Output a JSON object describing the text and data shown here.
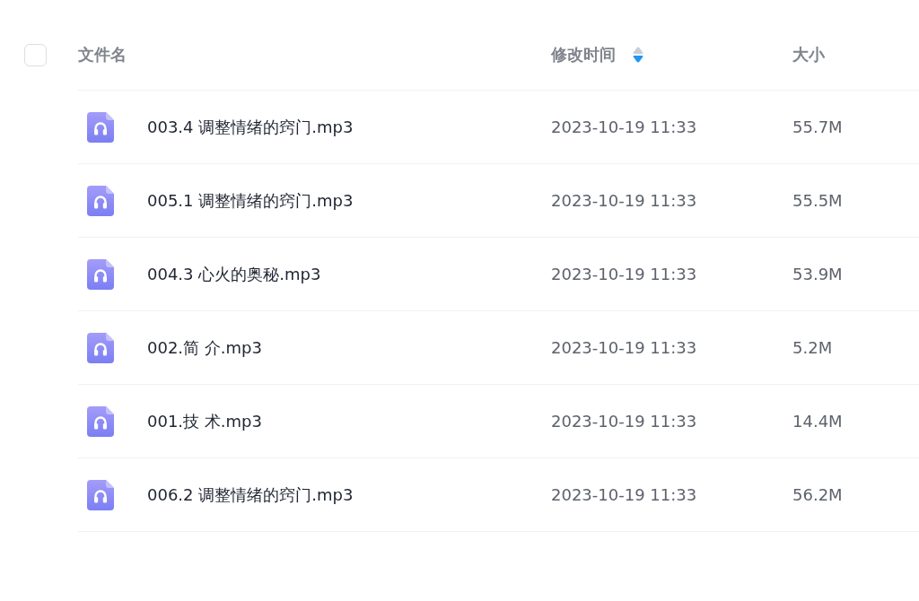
{
  "select_all_checkbox": {
    "checked": false
  },
  "table": {
    "columns": [
      {
        "label": "文件名"
      },
      {
        "label": "修改时间",
        "sort_descending": true
      },
      {
        "label": "大小"
      }
    ],
    "rows": [
      {
        "name": "003.4 调整情绪的窍门.mp3",
        "modified": "2023-10-19 11:33",
        "size": "55.7M"
      },
      {
        "name": "005.1 调整情绪的窍门.mp3",
        "modified": "2023-10-19 11:33",
        "size": "55.5M"
      },
      {
        "name": "004.3 心火的奥秘.mp3",
        "modified": "2023-10-19 11:33",
        "size": "53.9M"
      },
      {
        "name": "002.简 介.mp3",
        "modified": "2023-10-19 11:33",
        "size": "5.2M"
      },
      {
        "name": "001.技 术.mp3",
        "modified": "2023-10-19 11:33",
        "size": "14.4M"
      },
      {
        "name": "006.2 调整情绪的窍门.mp3",
        "modified": "2023-10-19 11:33",
        "size": "56.2M"
      }
    ]
  }
}
